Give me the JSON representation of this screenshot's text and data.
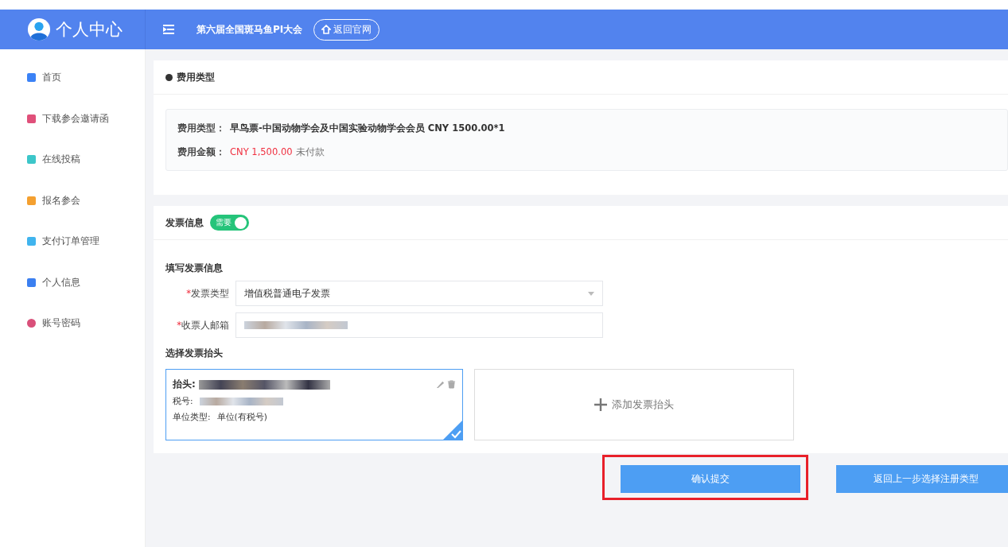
{
  "header": {
    "title": "个人中心",
    "conference": "第六届全国斑马鱼PI大会",
    "back_link": "返回官网"
  },
  "sidebar": {
    "items": [
      {
        "label": "首页",
        "color": "#3b82f6"
      },
      {
        "label": "下载参会邀请函",
        "color": "#e0507a"
      },
      {
        "label": "在线投稿",
        "color": "#3cc6c9"
      },
      {
        "label": "报名参会",
        "color": "#f4a030"
      },
      {
        "label": "支付订单管理",
        "color": "#40b4ee"
      },
      {
        "label": "个人信息",
        "color": "#3b7ff0"
      },
      {
        "label": "账号密码",
        "color": "#d9507a"
      }
    ]
  },
  "fee": {
    "title": "费用类型",
    "rows": [
      {
        "kind": "type",
        "label": "费用类型：",
        "value": "早鸟票-中国动物学会及中国实验动物学会会员 CNY 1500.00*1"
      },
      {
        "kind": "amount",
        "label": "费用金额：",
        "value": "CNY 1,500.00",
        "status": "未付款"
      }
    ]
  },
  "invoice": {
    "title": "发票信息",
    "toggle": {
      "label": "需要",
      "on": true
    },
    "form_title": "填写发票信息",
    "fields": [
      {
        "kind": "select",
        "required_mark": "*",
        "label": "发票类型",
        "value": "增值税普通电子发票"
      },
      {
        "kind": "input",
        "required_mark": "*",
        "label": "收票人邮箱"
      }
    ],
    "header_title": "选择发票抬头",
    "cards": [
      {
        "name_label": "抬头:",
        "tax_label": "税号:",
        "type_label": "单位类型:",
        "type_value": "单位(有税号)",
        "selected": true
      }
    ],
    "add_card": "添加发票抬头"
  },
  "buttons": [
    {
      "label": "确认提交",
      "highlighted": true
    },
    {
      "label": "返回上一步选择注册类型",
      "highlighted": false
    }
  ]
}
